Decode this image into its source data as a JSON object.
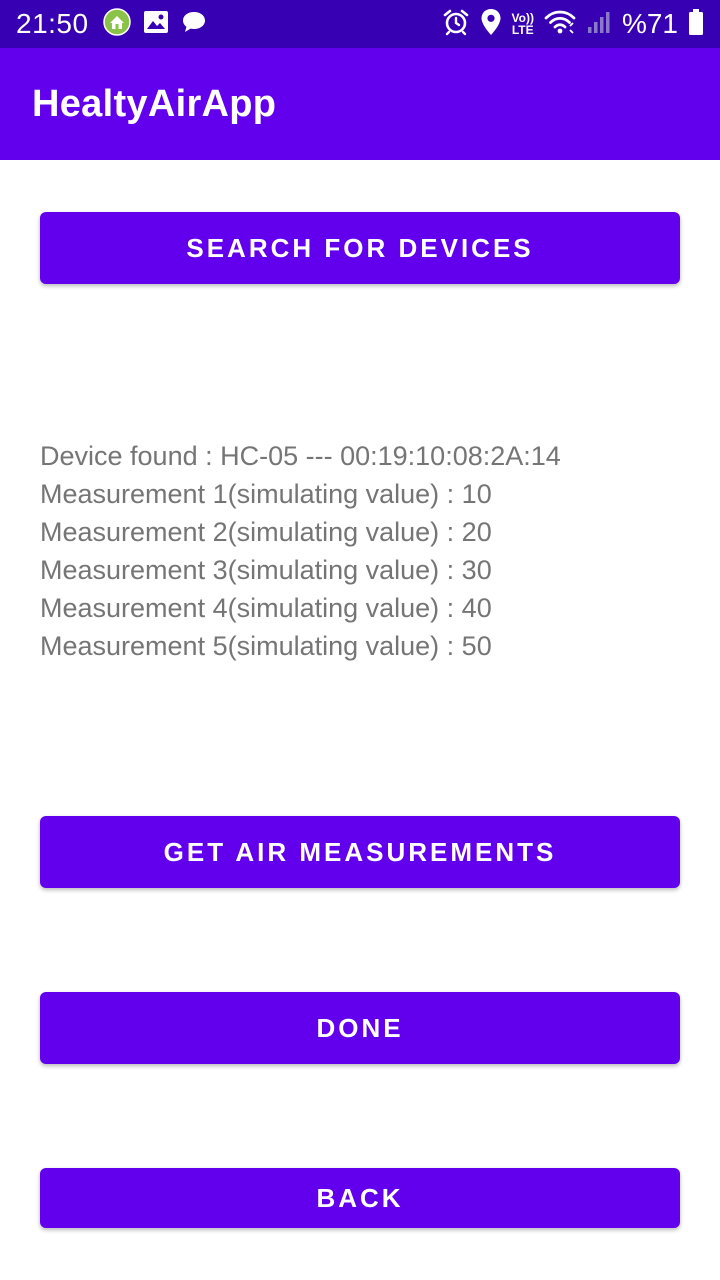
{
  "status_bar": {
    "time": "21:50",
    "battery_text": "%71",
    "left_icons": [
      "home-app-icon",
      "image-icon",
      "chat-bubble-icon"
    ],
    "right_icons": [
      "alarm-icon",
      "location-icon",
      "volte-icon",
      "wifi-icon",
      "signal-icon",
      "battery-icon"
    ],
    "volte_top": "Vo))",
    "volte_bottom": "LTE"
  },
  "app_bar": {
    "title": "HealtyAirApp"
  },
  "buttons": {
    "search": "Search for devices",
    "get_measurements": "Get air measurements",
    "done": "Done",
    "back": "Back"
  },
  "results": {
    "lines": [
      "Device found : HC-05 --- 00:19:10:08:2A:14",
      "Measurement 1(simulating value) : 10",
      "Measurement 2(simulating value) : 20",
      "Measurement 3(simulating value) : 30",
      "Measurement 4(simulating value) : 40",
      "Measurement 5(simulating value) : 50"
    ]
  },
  "colors": {
    "status_bar": "#3700B3",
    "primary": "#6200EE",
    "result_text": "#757575",
    "background": "#FFFFFF"
  }
}
